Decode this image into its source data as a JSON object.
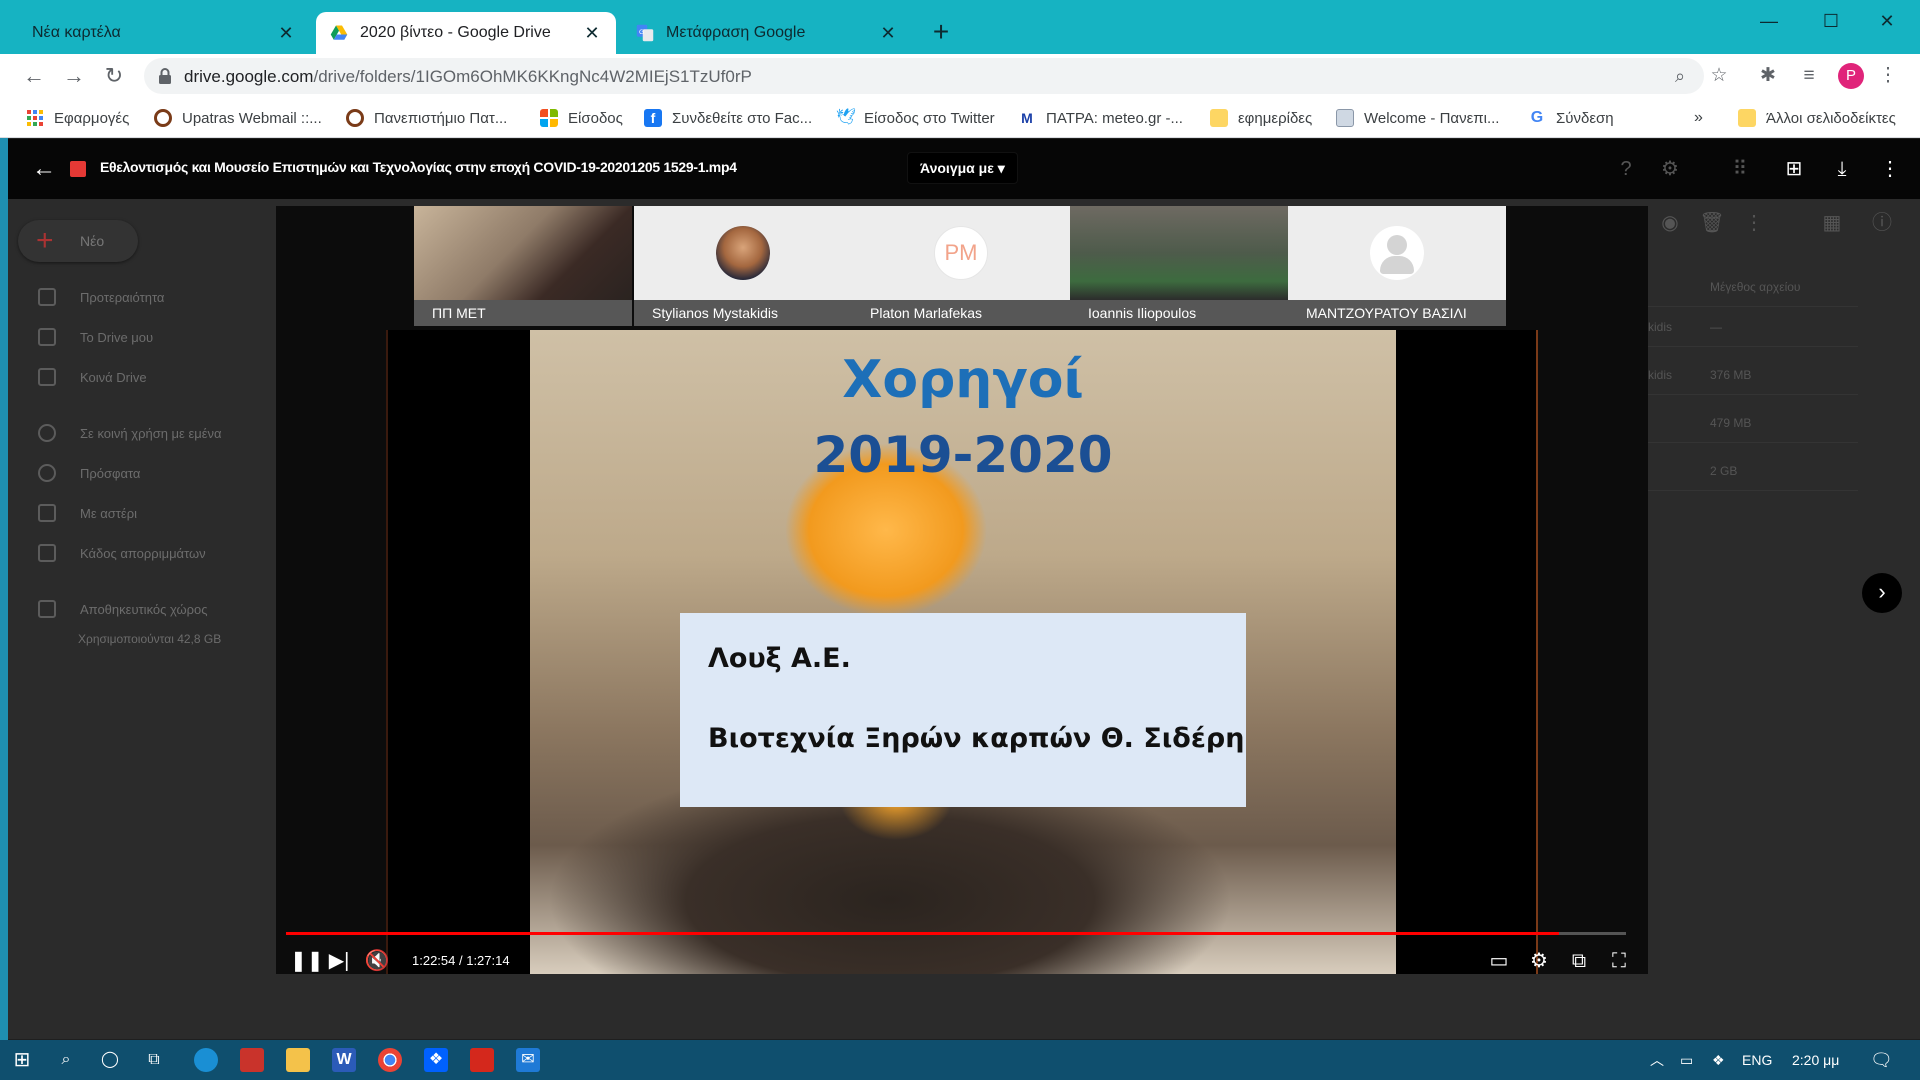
{
  "tabs": [
    {
      "title": "Νέα καρτέλα",
      "favicon": "none"
    },
    {
      "title": "2020 βίντεο - Google Drive",
      "favicon": "google-drive-icon"
    },
    {
      "title": "Μετάφραση Google",
      "favicon": "google-translate-icon"
    }
  ],
  "address_bar": {
    "host": "drive.google.com",
    "path": "/drive/folders/1IGOm6OhMK6KKngNc4W2MIEjS1TzUf0rP"
  },
  "profile_initial": "P",
  "bookmarks": [
    {
      "label": "Εφαρμογές",
      "icon": "apps-grid-icon"
    },
    {
      "label": "Upatras Webmail ::...",
      "icon": "upatras-icon"
    },
    {
      "label": "Πανεπιστήμιο Πατ...",
      "icon": "upatras-icon"
    },
    {
      "label": "Είσοδος",
      "icon": "microsoft-icon"
    },
    {
      "label": "Συνδεθείτε στο Fac...",
      "icon": "facebook-icon"
    },
    {
      "label": "Είσοδος στο Twitter",
      "icon": "twitter-icon"
    },
    {
      "label": "ΠΑΤΡΑ: meteo.gr -...",
      "icon": "meteo-icon"
    },
    {
      "label": "εφημερίδες",
      "icon": "folder-icon"
    },
    {
      "label": "Welcome - Πανεπι...",
      "icon": "page-icon"
    },
    {
      "label": "Σύνδεση",
      "icon": "google-icon"
    },
    {
      "label": "Άλλοι σελιδοδείκτες",
      "icon": "folder-icon"
    }
  ],
  "drive": {
    "new_label": "Νέο",
    "nav": [
      "Προτεραιότητα",
      "Το Drive μου",
      "Κοινά Drive",
      "Σε κοινή χρήση με εμένα",
      "Πρόσφατα",
      "Με αστέρι",
      "Κάδος απορριμμάτων",
      "Αποθηκευτικός χώρος"
    ],
    "storage_text": "Χρησιμοποιούνται 42,8 GB",
    "size_header": "Μέγεθος αρχείου",
    "rows": [
      {
        "owner": "kidis",
        "size": "—"
      },
      {
        "owner": "kidis",
        "size": "376 MB"
      },
      {
        "owner": "",
        "size": "479 MB"
      },
      {
        "owner": "",
        "size": "2 GB"
      }
    ]
  },
  "viewer": {
    "file_title": "Εθελοντισμός και Μουσείο Επιστημών και Τεχνολογίας στην εποχή COVID-19-20201205 1529-1.mp4",
    "open_with": "Άνοιγμα με"
  },
  "participants": [
    {
      "name": "ΠΠ ΜΕΤ",
      "type": "video"
    },
    {
      "name": "Stylianos Mystakidis",
      "type": "photo"
    },
    {
      "name": "Platon Marlafekas",
      "type": "initials",
      "initials": "PM"
    },
    {
      "name": "Ioannis Iliopoulos",
      "type": "video"
    },
    {
      "name": "ΜΑΝΤΖΟΥΡΑΤΟΥ ΒΑΣΙΛΙ",
      "type": "placeholder"
    }
  ],
  "slide": {
    "title": "Χορηγοί",
    "years": "2019-2020",
    "sponsors": [
      "Λουξ Α.Ε.",
      "Βιοτεχνία Ξηρών καρπών Θ. Σιδέρη"
    ]
  },
  "player": {
    "current_time": "1:22:54",
    "duration": "1:27:14",
    "time_display": "1:22:54 / 1:27:14",
    "progress_fraction": 0.95
  },
  "taskbar": {
    "language": "ENG",
    "clock": "2:20 μμ"
  }
}
